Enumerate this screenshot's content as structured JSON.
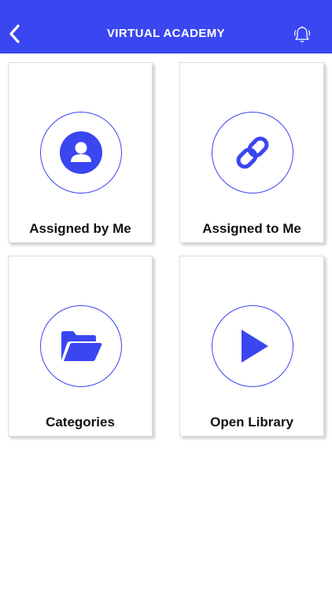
{
  "header": {
    "title": "VIRTUAL ACADEMY",
    "back_icon": "chevron-left-icon",
    "bell_icon": "bell-outline-icon",
    "background": "#3a46f0"
  },
  "tiles": [
    {
      "label": "Assigned by Me",
      "icon": "user-avatar-icon"
    },
    {
      "label": "Assigned to Me",
      "icon": "link-icon"
    },
    {
      "label": "Categories",
      "icon": "folder-open-icon"
    },
    {
      "label": "Open Library",
      "icon": "play-icon"
    }
  ],
  "colors": {
    "accent": "#3a46f0",
    "tile_border": "#dcdcdc",
    "text": "#111111"
  }
}
